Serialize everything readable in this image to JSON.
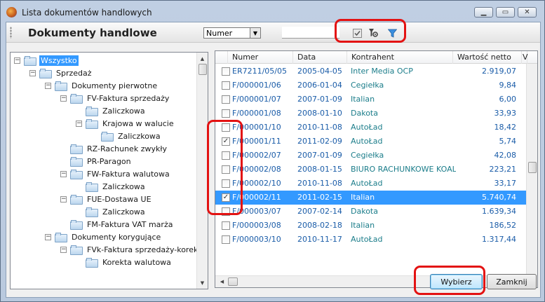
{
  "window": {
    "title": "Lista dokumentów handlowych"
  },
  "toolbar": {
    "title": "Dokumenty handlowe",
    "search_field": "Numer",
    "search_value": ""
  },
  "tree": [
    {
      "label": "Wszystko",
      "level": 0,
      "expander": "−",
      "selected": true
    },
    {
      "label": "Sprzedaż",
      "level": 1,
      "expander": "−"
    },
    {
      "label": "Dokumenty pierwotne",
      "level": 2,
      "expander": "−"
    },
    {
      "label": "FV-Faktura sprzedaży",
      "level": 3,
      "expander": "−"
    },
    {
      "label": "Zaliczkowa",
      "level": 4,
      "expander": ""
    },
    {
      "label": "Krajowa w walucie",
      "level": 4,
      "expander": "−"
    },
    {
      "label": "Zaliczkowa",
      "level": 5,
      "expander": ""
    },
    {
      "label": "RZ-Rachunek zwykły",
      "level": 3,
      "expander": ""
    },
    {
      "label": "PR-Paragon",
      "level": 3,
      "expander": ""
    },
    {
      "label": "FW-Faktura walutowa",
      "level": 3,
      "expander": "−"
    },
    {
      "label": "Zaliczkowa",
      "level": 4,
      "expander": ""
    },
    {
      "label": "FUE-Dostawa UE",
      "level": 3,
      "expander": "−"
    },
    {
      "label": "Zaliczkowa",
      "level": 4,
      "expander": ""
    },
    {
      "label": "FM-Faktura VAT marża",
      "level": 3,
      "expander": ""
    },
    {
      "label": "Dokumenty korygujące",
      "level": 2,
      "expander": "−"
    },
    {
      "label": "FVk-Faktura sprzedaży-korekta",
      "level": 3,
      "expander": "−"
    },
    {
      "label": "Korekta walutowa",
      "level": 4,
      "expander": ""
    }
  ],
  "grid": {
    "columns": {
      "num": "Numer",
      "date": "Data",
      "kontr": "Kontrahent",
      "val": "Wartość netto",
      "extra": "V"
    },
    "rows": [
      {
        "num": "ER7211/05/05",
        "date": "2005-04-05",
        "kontr": "Inter Media OCP",
        "val": "2.919,07",
        "checked": false,
        "selected": false
      },
      {
        "num": "F/000001/06",
        "date": "2006-01-04",
        "kontr": "Cegiełka",
        "val": "9,84",
        "checked": false,
        "selected": false
      },
      {
        "num": "F/000001/07",
        "date": "2007-01-09",
        "kontr": "Italian",
        "val": "6,00",
        "checked": false,
        "selected": false
      },
      {
        "num": "F/000001/08",
        "date": "2008-01-10",
        "kontr": "Dakota",
        "val": "33,93",
        "checked": false,
        "selected": false
      },
      {
        "num": "F/000001/10",
        "date": "2010-11-08",
        "kontr": "AutoŁad",
        "val": "18,42",
        "checked": false,
        "selected": false
      },
      {
        "num": "F/000001/11",
        "date": "2011-02-09",
        "kontr": "AutoŁad",
        "val": "5,74",
        "checked": true,
        "selected": false
      },
      {
        "num": "F/000002/07",
        "date": "2007-01-09",
        "kontr": "Cegiełka",
        "val": "42,08",
        "checked": false,
        "selected": false
      },
      {
        "num": "F/000002/08",
        "date": "2008-01-15",
        "kontr": "BIURO RACHUNKOWE KOAL",
        "val": "223,21",
        "checked": false,
        "selected": false
      },
      {
        "num": "F/000002/10",
        "date": "2010-11-08",
        "kontr": "AutoŁad",
        "val": "33,17",
        "checked": false,
        "selected": false
      },
      {
        "num": "F/000002/11",
        "date": "2011-02-15",
        "kontr": "Italian",
        "val": "5.740,74",
        "checked": true,
        "selected": true
      },
      {
        "num": "F/000003/07",
        "date": "2007-02-14",
        "kontr": "Dakota",
        "val": "1.639,34",
        "checked": false,
        "selected": false
      },
      {
        "num": "F/000003/08",
        "date": "2008-02-18",
        "kontr": "Italian",
        "val": "186,52",
        "checked": false,
        "selected": false
      },
      {
        "num": "F/000003/10",
        "date": "2010-11-17",
        "kontr": "AutoŁad",
        "val": "1.317,44",
        "checked": false,
        "selected": false
      }
    ]
  },
  "buttons": {
    "select": "Wybierz",
    "close": "Zamknij"
  },
  "colors": {
    "selection": "#3399ff",
    "highlight": "#e31212",
    "link_text": "#1a5ca8",
    "contractor_text": "#1b7d8a"
  }
}
